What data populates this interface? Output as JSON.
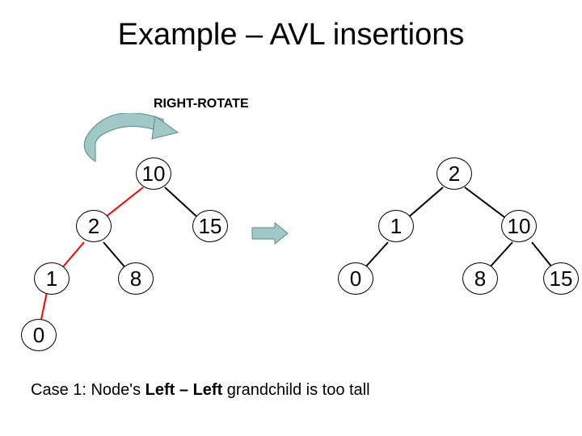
{
  "title": "Example – AVL insertions",
  "rotate_label": "RIGHT-ROTATE",
  "caption_prefix": "Case 1: Node's ",
  "caption_bold": "Left – Left",
  "caption_suffix": " grandchild is too tall",
  "colors": {
    "arrow_fill": "#9fc8c6",
    "arrow_dark": "#5a8a88",
    "edge_red": "#ff0000",
    "edge_black": "#000000"
  },
  "left_tree": {
    "nodes": {
      "root": "10",
      "l": "2",
      "r": "15",
      "ll": "1",
      "lr": "8",
      "lll": "0"
    }
  },
  "right_tree": {
    "nodes": {
      "root": "2",
      "l": "1",
      "r": "10",
      "ll": "0",
      "rl": "8",
      "rr": "15"
    }
  }
}
